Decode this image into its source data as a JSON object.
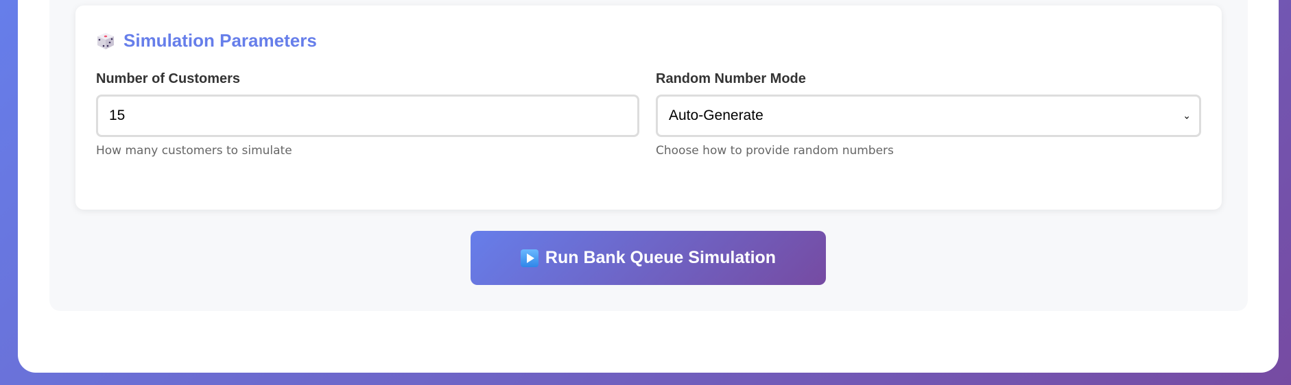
{
  "params": {
    "title_icon": "dice-icon",
    "title": "Simulation Parameters",
    "customers": {
      "label": "Number of Customers",
      "value": "15",
      "help": "How many customers to simulate"
    },
    "mode": {
      "label": "Random Number Mode",
      "selected": "Auto-Generate",
      "help": "Choose how to provide random numbers"
    }
  },
  "run_button": {
    "icon": "play-icon",
    "label": "Run Bank Queue Simulation"
  },
  "colors": {
    "accent": "#667eea",
    "accent_end": "#764ba2"
  }
}
